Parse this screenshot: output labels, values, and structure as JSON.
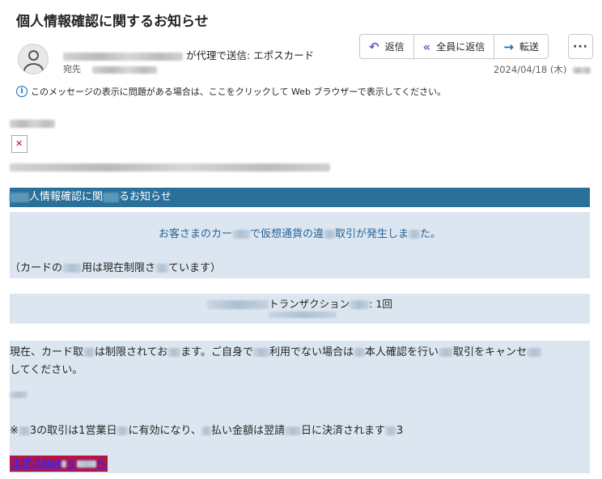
{
  "subject": "個人情報確認に関するお知らせ",
  "header": {
    "from_suffix": "が代理で送信: エポスカード",
    "to_label": "宛先",
    "date": "2024/04/18 (木)"
  },
  "actions": {
    "reply": "返信",
    "reply_all": "全員に返信",
    "forward": "転送",
    "more": "···"
  },
  "infobar": {
    "text": "このメッセージの表示に問題がある場合は、ここをクリックして Web ブラウザーで表示してください。"
  },
  "body": {
    "banner_a": "人情報確認に関",
    "banner_b": "るお知らせ",
    "p1_a": "お客さまのカー",
    "p1_b": "で仮想通貨の違",
    "p1_c": "取引が発生しま",
    "p1_d": "た。",
    "p1_line2_a": "（カードの",
    "p1_line2_b": "用は現在制限さ",
    "p1_line2_c": "ています）",
    "p2_a": "トランザクション",
    "p2_b": ": 1回",
    "p3_a": "現在、カード取",
    "p3_b": "は制限されてお",
    "p3_c": "ます。ご自身で",
    "p3_d": "利用でない場合は",
    "p3_e": "本人確認を行い",
    "p3_f": "取引をキャンセ",
    "p3_g": "してください。",
    "p3_note_a": "※",
    "p3_note_b": "3の取引は1営業日",
    "p3_note_c": "に有効になり、",
    "p3_note_d": "払い金額は翌請",
    "p3_note_e": "日に決済されます",
    "p3_note_f": "3",
    "link_a": "エポスNet",
    "link_b": "ッ",
    "link_c": "へ"
  },
  "colors": {
    "banner": "#2a7098",
    "panel": "#dbe6f0",
    "link_bg": "#b0164a",
    "link_text": "#2a2aff",
    "accent": "#5b5fc7"
  }
}
